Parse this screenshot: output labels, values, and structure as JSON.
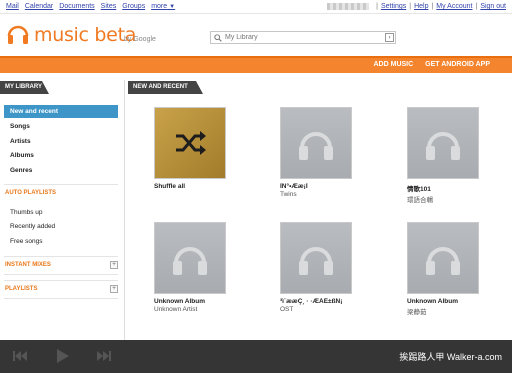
{
  "gbar": {
    "links": [
      "Mail",
      "Calendar",
      "Documents",
      "Sites",
      "Groups"
    ],
    "more": "more",
    "right_links": [
      "Settings",
      "Help",
      "My Account",
      "Sign out"
    ]
  },
  "header": {
    "logo": "music beta",
    "by_google": "by Google",
    "search_placeholder": "My Library"
  },
  "topbar": {
    "add_music": "ADD MUSIC",
    "get_android_app": "GET ANDROID APP"
  },
  "sidebar": {
    "my_library": "MY LIBRARY",
    "library_items": [
      "New and recent",
      "Songs",
      "Artists",
      "Albums",
      "Genres"
    ],
    "auto_playlists": "AUTO PLAYLISTS",
    "auto_items": [
      "Thumbs up",
      "Recently added",
      "Free songs"
    ],
    "instant_mixes": "INSTANT MIXES",
    "playlists": "PLAYLISTS"
  },
  "main": {
    "section_title": "NEW AND RECENT",
    "cards": [
      {
        "title": "Shuffle all",
        "subtitle": ""
      },
      {
        "title": "ÌÑ°•Ææ¡Ì",
        "subtitle": "Twins"
      },
      {
        "title": "情歌101",
        "subtitle": "環語合輯"
      },
      {
        "title": "Unknown Album",
        "subtitle": "Unknown Artist"
      },
      {
        "title": "³ì¨ææÇ¸ · ·ÆÁÉ±ßÑ¡",
        "subtitle": "OST"
      },
      {
        "title": "Unknown Album",
        "subtitle": "梁静茹"
      }
    ]
  },
  "player": {
    "watermark": "挨踢路人甲 Walker-a.com"
  },
  "colors": {
    "accent_orange": "#f4842d",
    "selected_blue": "#3e96c8",
    "dark_bar": "#353535"
  }
}
